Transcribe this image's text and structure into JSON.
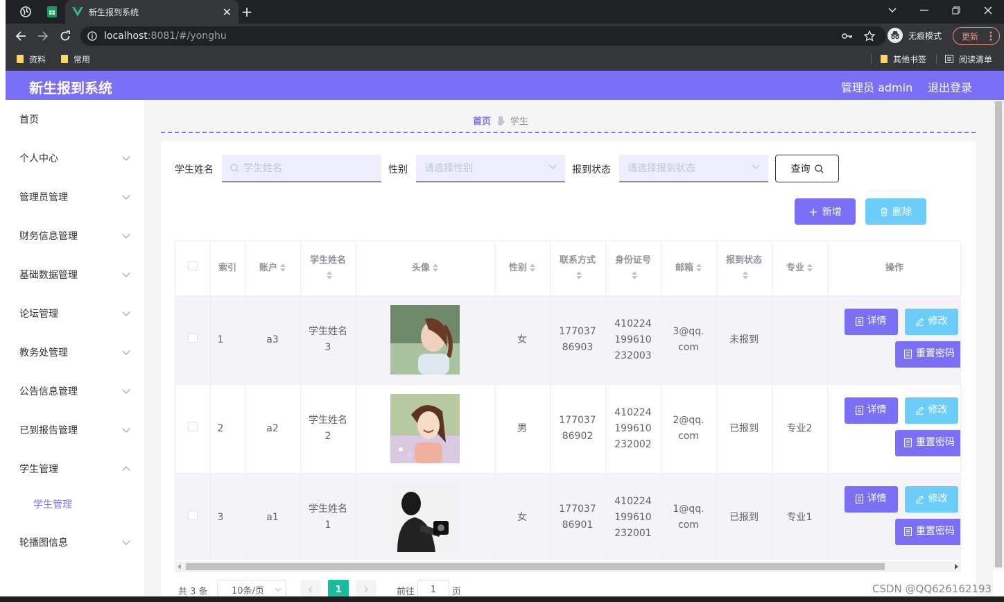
{
  "browser": {
    "tab_title": "新生报到系统",
    "url_host": "localhost",
    "url_rest": ":8081/#/yonghu",
    "incognito_label": "无痕模式",
    "update_label": "更新",
    "bookmarks": [
      "资料",
      "常用"
    ],
    "bookmarks_right": [
      "其他书签",
      "阅读清单"
    ]
  },
  "header": {
    "app_title": "新生报到系统",
    "user_label": "管理员 admin",
    "logout_label": "退出登录",
    "accent_color": "#7b6ff5"
  },
  "sidebar": {
    "items": [
      {
        "label": "首页",
        "expandable": false
      },
      {
        "label": "个人中心",
        "expandable": true
      },
      {
        "label": "管理员管理",
        "expandable": true
      },
      {
        "label": "财务信息管理",
        "expandable": true
      },
      {
        "label": "基础数据管理",
        "expandable": true
      },
      {
        "label": "论坛管理",
        "expandable": true
      },
      {
        "label": "教务处管理",
        "expandable": true
      },
      {
        "label": "公告信息管理",
        "expandable": true
      },
      {
        "label": "已到报告管理",
        "expandable": true
      },
      {
        "label": "学生管理",
        "expandable": true,
        "open": true
      },
      {
        "label": "轮播图信息",
        "expandable": true
      }
    ],
    "sub_item": "学生管理"
  },
  "breadcrumb": {
    "home": "首页",
    "current": "学生"
  },
  "search": {
    "name_label": "学生姓名",
    "name_placeholder": "学生姓名",
    "gender_label": "性别",
    "gender_placeholder": "请选择性别",
    "status_label": "报到状态",
    "status_placeholder": "请选择报到状态",
    "query_label": "查询"
  },
  "actions": {
    "add_label": "新增",
    "delete_label": "删除"
  },
  "table": {
    "headers": [
      "索引",
      "账户",
      "学生姓名",
      "头像",
      "性别",
      "联系方式",
      "身份证号",
      "邮箱",
      "报到状态",
      "专业",
      "操作"
    ],
    "rows": [
      {
        "index": "1",
        "account": "a3",
        "name": "学生姓名3",
        "gender": "女",
        "phone": "17703786903",
        "id_no": "410224199610232003",
        "email": "3@qq.com",
        "status": "未报到",
        "major": ""
      },
      {
        "index": "2",
        "account": "a2",
        "name": "学生姓名2",
        "gender": "男",
        "phone": "17703786902",
        "id_no": "410224199610232002",
        "email": "2@qq.com",
        "status": "已报到",
        "major": "专业2"
      },
      {
        "index": "3",
        "account": "a1",
        "name": "学生姓名1",
        "gender": "女",
        "phone": "17703786901",
        "id_no": "410224199610232001",
        "email": "1@qq.com",
        "status": "已报到",
        "major": "专业1"
      }
    ],
    "op_labels": {
      "detail": "详情",
      "edit": "修改",
      "reset": "重置密码"
    }
  },
  "pagination": {
    "total": "共 3 条",
    "page_size": "10条/页",
    "current_page": "1",
    "goto_label": "前往",
    "goto_value": "1",
    "page_suffix": "页"
  },
  "watermark": "CSDN @QQ626162193"
}
